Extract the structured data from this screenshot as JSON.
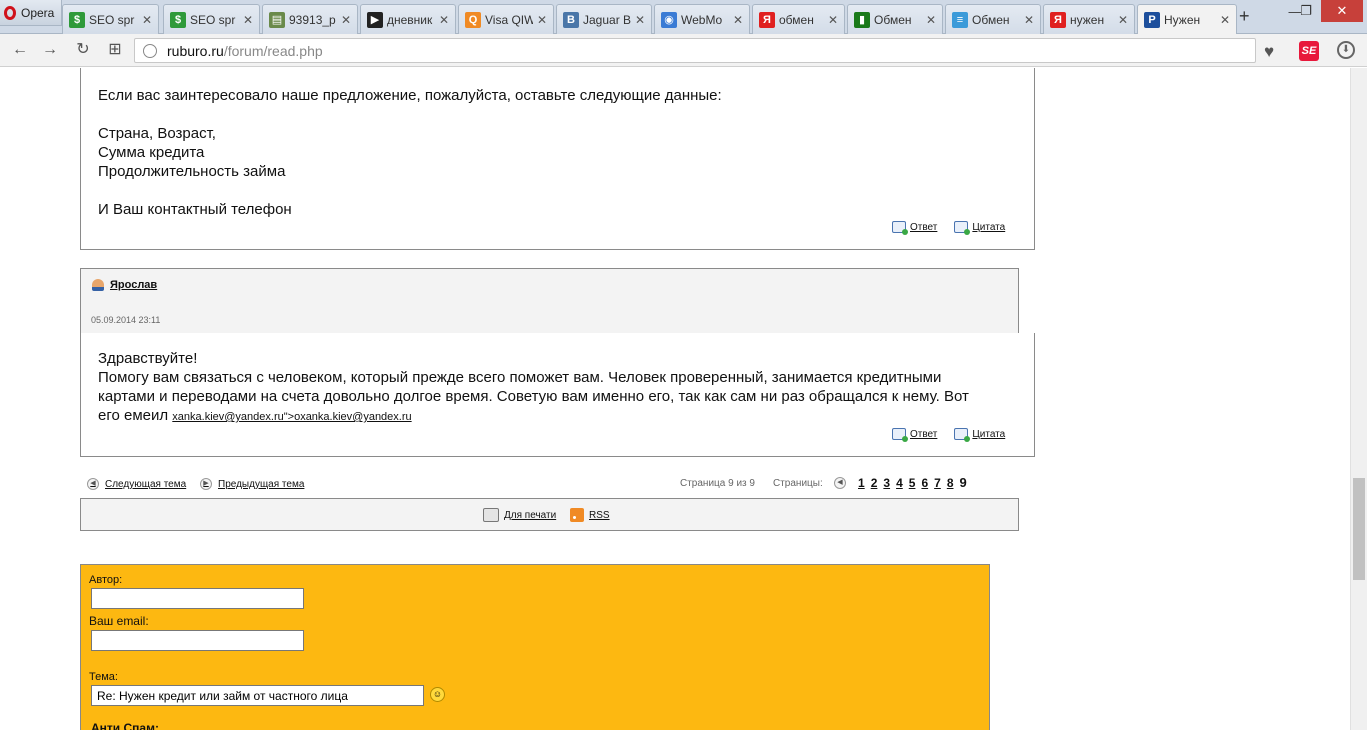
{
  "browser": {
    "opera_label": "Opera",
    "tabs": [
      {
        "label": "SEO spr",
        "color": "#2f9a3a",
        "glyph": "$"
      },
      {
        "label": "SEO spr",
        "color": "#2f9a3a",
        "glyph": "$"
      },
      {
        "label": "93913_p",
        "color": "#6a8a4a",
        "glyph": "▤"
      },
      {
        "label": "дневник",
        "color": "#222222",
        "glyph": "▶"
      },
      {
        "label": "Visa QIW",
        "color": "#f08a24",
        "glyph": "Q"
      },
      {
        "label": "Jaguar B",
        "color": "#4a76a8",
        "glyph": "B"
      },
      {
        "label": "WebMo",
        "color": "#3a7bd5",
        "glyph": "◉"
      },
      {
        "label": "обмен",
        "color": "#e02020",
        "glyph": "Я"
      },
      {
        "label": "Обмен",
        "color": "#1a7a1a",
        "glyph": "▮"
      },
      {
        "label": "Обмен",
        "color": "#3b9ad9",
        "glyph": "≡"
      },
      {
        "label": "нужен",
        "color": "#e02020",
        "glyph": "Я"
      },
      {
        "label": "Нужен",
        "color": "#1d4f9c",
        "glyph": "P"
      }
    ],
    "newtab": "+",
    "minimize": "—",
    "restore": "❐",
    "close": "✕",
    "back": "←",
    "forward": "→",
    "reload": "↻",
    "grid": "⊞",
    "url_host": "ruburo.ru",
    "url_path": "/forum/read.php",
    "heart": "♥",
    "ext_label": "SE",
    "download": "⬇"
  },
  "post1": {
    "intro": "Если вас заинтересовало наше предложение, пожалуйста, оставьте следующие данные:",
    "line1": "Страна, Возраст,",
    "line2": "Сумма кредита",
    "line3": "Продолжительность займа",
    "line4": "И Ваш контактный телефон",
    "reply": "Ответ",
    "quote": "Цитата"
  },
  "post2": {
    "author": "Ярослав",
    "date": "05.09.2014 23:11",
    "greeting": "Здравствуйте!",
    "line1": "Помогу вам связаться с человеком, который прежде всего поможет вам. Человек проверенный, занимается кредитными",
    "line2": "картами и переводами на счета довольно долгое время. Советую вам именно его, так как сам ни раз обращался к нему. Вот",
    "line3_prefix": "его емеил",
    "email_link": "xanka.kiev@yandex.ru\">oxanka.kiev@yandex.ru",
    "reply": "Ответ",
    "quote": "Цитата"
  },
  "nav": {
    "next_topic": "Следующая тема",
    "prev_topic": "Предыдущая тема",
    "page_info": "Страница 9 из 9",
    "pages_label": "Страницы:",
    "pages": [
      "1",
      "2",
      "3",
      "4",
      "5",
      "6",
      "7",
      "8"
    ],
    "current_page": "9"
  },
  "print": {
    "print_label": "Для печати",
    "rss_label": "RSS"
  },
  "form": {
    "author_label": "Автор:",
    "author_value": "",
    "email_label": "Ваш email:",
    "email_value": "",
    "subject_label": "Тема:",
    "subject_value": "Re: Нужен кредит или займ от частного лица",
    "antispam_label": "Анти Спам:",
    "form_color": "#fdb811"
  }
}
